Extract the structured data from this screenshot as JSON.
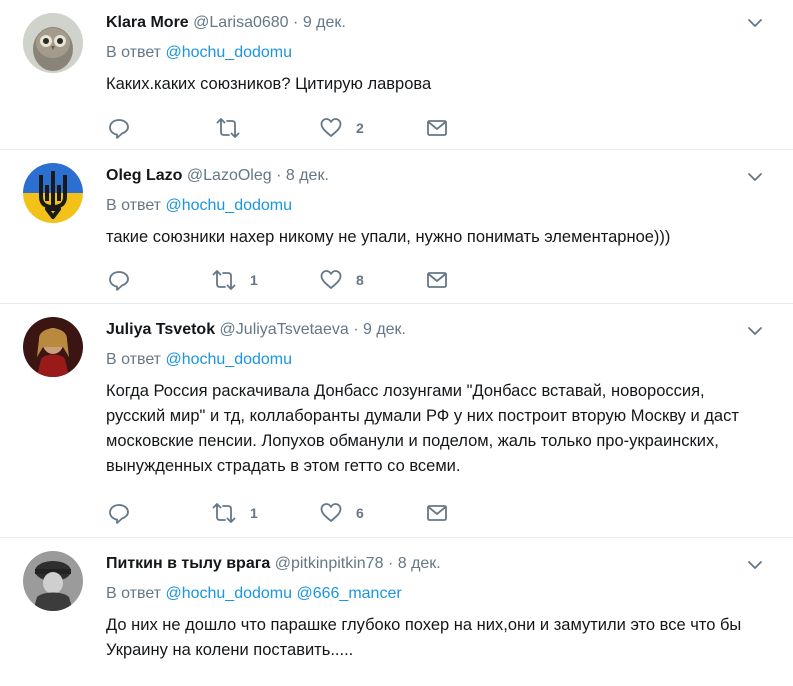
{
  "tweets": [
    {
      "name": "Klara More",
      "handle": "@Larisa0680",
      "dot": "·",
      "time": "9 дек.",
      "reply_prefix": "В ответ",
      "mentions": [
        "@hochu_dodomu"
      ],
      "text": "Каких.каких союзников? Цитирую лаврова",
      "replies": "",
      "retweets": "",
      "likes": "2"
    },
    {
      "name": "Oleg Lazo",
      "handle": "@LazoOleg",
      "dot": "·",
      "time": "8 дек.",
      "reply_prefix": "В ответ",
      "mentions": [
        "@hochu_dodomu"
      ],
      "text": "такие союзники нахер никому не упали, нужно понимать элементарное)))",
      "replies": "",
      "retweets": "1",
      "likes": "8"
    },
    {
      "name": "Juliya Tsvetok",
      "handle": "@JuliyaTsvetaeva",
      "dot": "·",
      "time": "9 дек.",
      "reply_prefix": "В ответ",
      "mentions": [
        "@hochu_dodomu"
      ],
      "text": "Когда Россия раскачивала Донбасс лозунгами \"Донбасс вставай, новороссия, русский мир\" и тд, коллаборанты думали РФ у них построит вторую Москву и даст московские пенсии. Лопухов обманули и поделом, жаль только про-украинских, вынужденных страдать в этом гетто со всеми.",
      "replies": "",
      "retweets": "1",
      "likes": "6"
    },
    {
      "name": "Питкин в тылу врага",
      "handle": "@pitkinpitkin78",
      "dot": "·",
      "time": "8 дек.",
      "reply_prefix": "В ответ",
      "mentions": [
        "@hochu_dodomu",
        "@666_mancer"
      ],
      "text": "До них не дошло что парашке глубоко похер на них,они и замутили это все что бы Украину на колени поставить.....",
      "replies": "",
      "retweets": "",
      "likes": ""
    }
  ],
  "icons": {
    "reply": "reply-icon",
    "retweet": "retweet-icon",
    "like": "heart-icon",
    "message": "envelope-icon",
    "more": "chevron-down-icon"
  },
  "colors": {
    "link": "#1b95e0",
    "secondary": "#657786",
    "text": "#14171a",
    "divider": "#e6ecf0"
  }
}
